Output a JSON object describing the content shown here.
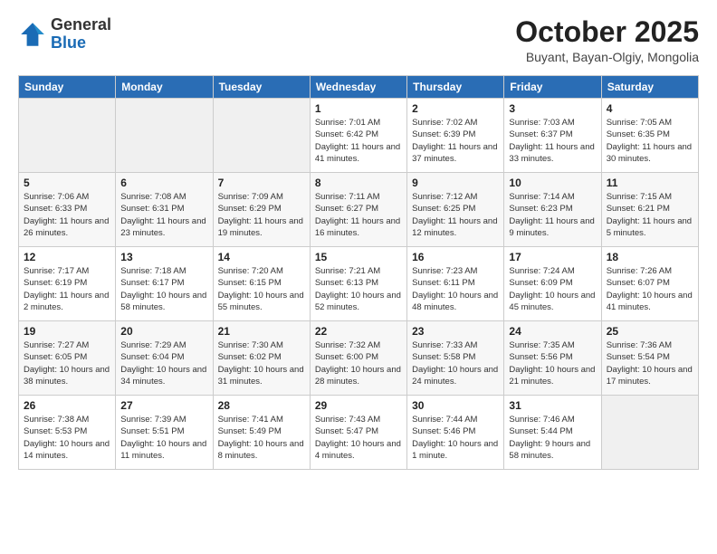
{
  "header": {
    "logo": {
      "general": "General",
      "blue": "Blue"
    },
    "title": "October 2025",
    "location": "Buyant, Bayan-Olgiy, Mongolia"
  },
  "days_of_week": [
    "Sunday",
    "Monday",
    "Tuesday",
    "Wednesday",
    "Thursday",
    "Friday",
    "Saturday"
  ],
  "weeks": [
    [
      {
        "day": "",
        "info": ""
      },
      {
        "day": "",
        "info": ""
      },
      {
        "day": "",
        "info": ""
      },
      {
        "day": "1",
        "info": "Sunrise: 7:01 AM\nSunset: 6:42 PM\nDaylight: 11 hours\nand 41 minutes."
      },
      {
        "day": "2",
        "info": "Sunrise: 7:02 AM\nSunset: 6:39 PM\nDaylight: 11 hours\nand 37 minutes."
      },
      {
        "day": "3",
        "info": "Sunrise: 7:03 AM\nSunset: 6:37 PM\nDaylight: 11 hours\nand 33 minutes."
      },
      {
        "day": "4",
        "info": "Sunrise: 7:05 AM\nSunset: 6:35 PM\nDaylight: 11 hours\nand 30 minutes."
      }
    ],
    [
      {
        "day": "5",
        "info": "Sunrise: 7:06 AM\nSunset: 6:33 PM\nDaylight: 11 hours\nand 26 minutes."
      },
      {
        "day": "6",
        "info": "Sunrise: 7:08 AM\nSunset: 6:31 PM\nDaylight: 11 hours\nand 23 minutes."
      },
      {
        "day": "7",
        "info": "Sunrise: 7:09 AM\nSunset: 6:29 PM\nDaylight: 11 hours\nand 19 minutes."
      },
      {
        "day": "8",
        "info": "Sunrise: 7:11 AM\nSunset: 6:27 PM\nDaylight: 11 hours\nand 16 minutes."
      },
      {
        "day": "9",
        "info": "Sunrise: 7:12 AM\nSunset: 6:25 PM\nDaylight: 11 hours\nand 12 minutes."
      },
      {
        "day": "10",
        "info": "Sunrise: 7:14 AM\nSunset: 6:23 PM\nDaylight: 11 hours\nand 9 minutes."
      },
      {
        "day": "11",
        "info": "Sunrise: 7:15 AM\nSunset: 6:21 PM\nDaylight: 11 hours\nand 5 minutes."
      }
    ],
    [
      {
        "day": "12",
        "info": "Sunrise: 7:17 AM\nSunset: 6:19 PM\nDaylight: 11 hours\nand 2 minutes."
      },
      {
        "day": "13",
        "info": "Sunrise: 7:18 AM\nSunset: 6:17 PM\nDaylight: 10 hours\nand 58 minutes."
      },
      {
        "day": "14",
        "info": "Sunrise: 7:20 AM\nSunset: 6:15 PM\nDaylight: 10 hours\nand 55 minutes."
      },
      {
        "day": "15",
        "info": "Sunrise: 7:21 AM\nSunset: 6:13 PM\nDaylight: 10 hours\nand 52 minutes."
      },
      {
        "day": "16",
        "info": "Sunrise: 7:23 AM\nSunset: 6:11 PM\nDaylight: 10 hours\nand 48 minutes."
      },
      {
        "day": "17",
        "info": "Sunrise: 7:24 AM\nSunset: 6:09 PM\nDaylight: 10 hours\nand 45 minutes."
      },
      {
        "day": "18",
        "info": "Sunrise: 7:26 AM\nSunset: 6:07 PM\nDaylight: 10 hours\nand 41 minutes."
      }
    ],
    [
      {
        "day": "19",
        "info": "Sunrise: 7:27 AM\nSunset: 6:05 PM\nDaylight: 10 hours\nand 38 minutes."
      },
      {
        "day": "20",
        "info": "Sunrise: 7:29 AM\nSunset: 6:04 PM\nDaylight: 10 hours\nand 34 minutes."
      },
      {
        "day": "21",
        "info": "Sunrise: 7:30 AM\nSunset: 6:02 PM\nDaylight: 10 hours\nand 31 minutes."
      },
      {
        "day": "22",
        "info": "Sunrise: 7:32 AM\nSunset: 6:00 PM\nDaylight: 10 hours\nand 28 minutes."
      },
      {
        "day": "23",
        "info": "Sunrise: 7:33 AM\nSunset: 5:58 PM\nDaylight: 10 hours\nand 24 minutes."
      },
      {
        "day": "24",
        "info": "Sunrise: 7:35 AM\nSunset: 5:56 PM\nDaylight: 10 hours\nand 21 minutes."
      },
      {
        "day": "25",
        "info": "Sunrise: 7:36 AM\nSunset: 5:54 PM\nDaylight: 10 hours\nand 17 minutes."
      }
    ],
    [
      {
        "day": "26",
        "info": "Sunrise: 7:38 AM\nSunset: 5:53 PM\nDaylight: 10 hours\nand 14 minutes."
      },
      {
        "day": "27",
        "info": "Sunrise: 7:39 AM\nSunset: 5:51 PM\nDaylight: 10 hours\nand 11 minutes."
      },
      {
        "day": "28",
        "info": "Sunrise: 7:41 AM\nSunset: 5:49 PM\nDaylight: 10 hours\nand 8 minutes."
      },
      {
        "day": "29",
        "info": "Sunrise: 7:43 AM\nSunset: 5:47 PM\nDaylight: 10 hours\nand 4 minutes."
      },
      {
        "day": "30",
        "info": "Sunrise: 7:44 AM\nSunset: 5:46 PM\nDaylight: 10 hours\nand 1 minute."
      },
      {
        "day": "31",
        "info": "Sunrise: 7:46 AM\nSunset: 5:44 PM\nDaylight: 9 hours\nand 58 minutes."
      },
      {
        "day": "",
        "info": ""
      }
    ]
  ]
}
